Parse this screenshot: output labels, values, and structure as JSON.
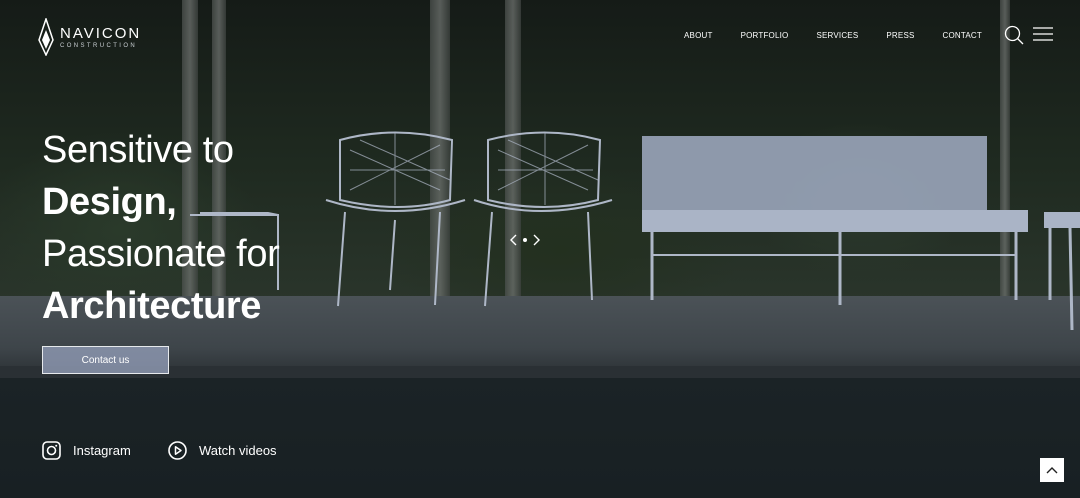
{
  "brand": {
    "name": "NAVICON",
    "tagline": "CONSTRUCTION"
  },
  "nav": {
    "items": [
      "ABOUT",
      "PORTFOLIO",
      "SERVICES",
      "PRESS",
      "CONTACT"
    ]
  },
  "header_icons": [
    "search-icon",
    "hamburger-menu-icon"
  ],
  "hero": {
    "line1": "Sensitive to",
    "line2": "Design,",
    "line3": "Passionate for",
    "line4": "Architecture",
    "cta_label": "Contact us"
  },
  "slider": {
    "icons": [
      "chevron-left-icon",
      "dot-icon",
      "chevron-right-icon"
    ]
  },
  "links": {
    "instagram_label": "Instagram",
    "videos_label": "Watch videos"
  },
  "colors": {
    "cta_bg": "#8c96af",
    "overlay": "#1c2326"
  }
}
